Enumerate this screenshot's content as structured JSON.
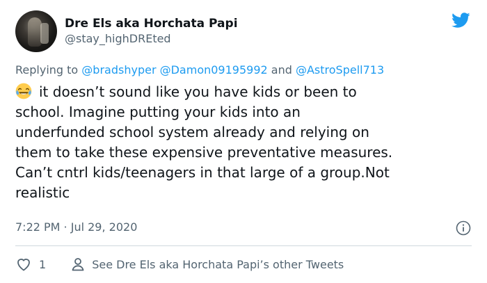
{
  "user": {
    "display_name": "Dre Els aka Horchata Papi",
    "handle": "@stay_highDREted"
  },
  "reply": {
    "prefix": "Replying to ",
    "mention1": "@bradshyper",
    "mention2": "@Damon09195992",
    "conjunction": " and ",
    "mention3": "@AstroSpell713"
  },
  "tweet": {
    "emoji_icon": "face-with-tears-of-joy-icon",
    "text": "it doesn’t sound like you have kids or been to\nschool. Imagine putting your kids into an\nunderfunded school system already and relying on\nthem to take these expensive preventative measures.\nCan’t cntrl kids/teenagers in that large of a group.Not\nrealistic",
    "timestamp": "7:22 PM · Jul 29, 2020"
  },
  "actions": {
    "like_count": "1",
    "see_other": "See Dre Els aka Horchata Papi’s other Tweets"
  },
  "colors": {
    "accent": "#1d9bf0",
    "secondary_text": "#536471",
    "divider": "#cfd9de"
  }
}
